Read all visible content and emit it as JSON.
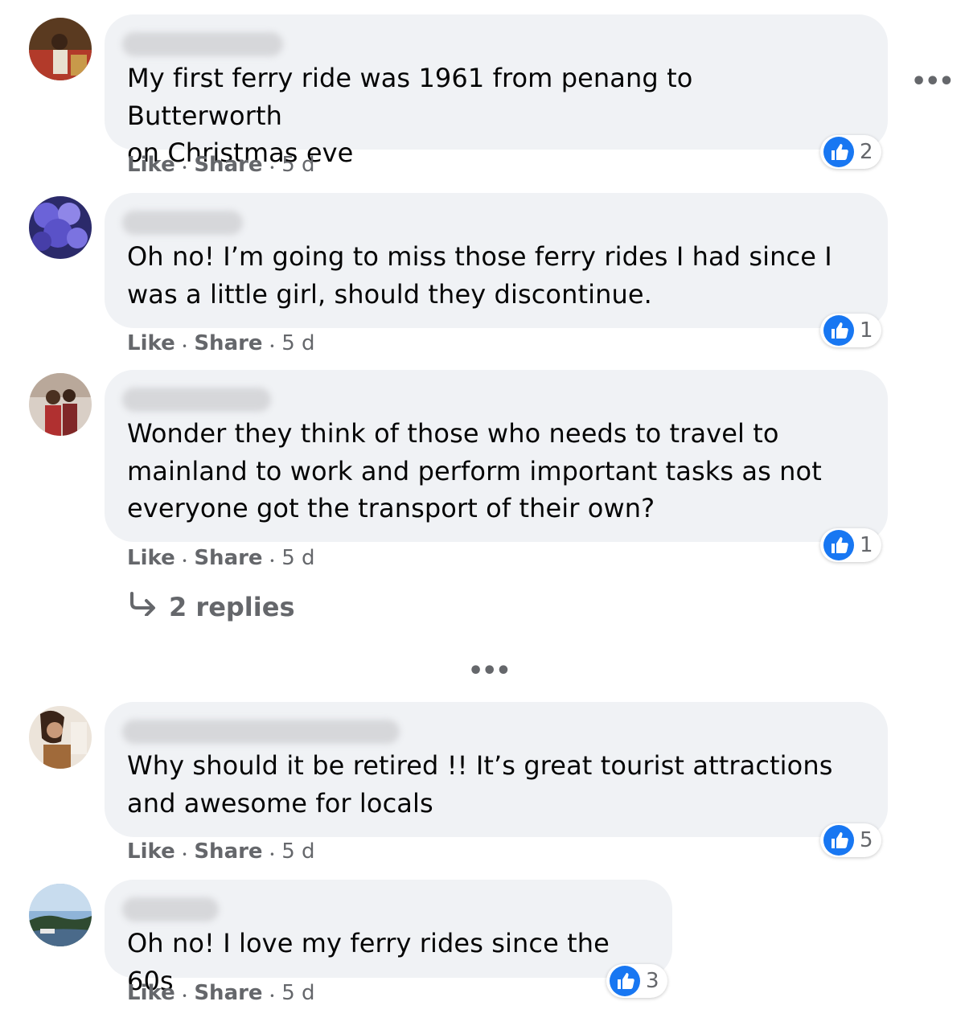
{
  "comments": [
    {
      "text": "My first ferry ride was 1961 from penang to Butterworth\non Christmas eve",
      "like_label": "Like",
      "share_label": "Share",
      "age": "5 d",
      "reactions": "2",
      "avatar_colors": [
        "#5a3a20",
        "#c89a4a"
      ]
    },
    {
      "text": "Oh no! I’m going to miss those ferry rides I had since I\nwas a little girl, should they discontinue.",
      "like_label": "Like",
      "share_label": "Share",
      "age": "5 d",
      "reactions": "1",
      "avatar_colors": [
        "#3b3a9c",
        "#8f86e8"
      ]
    },
    {
      "text": "Wonder they think of those who needs to travel to\nmainland to work and perform important tasks as not\neveryone got the transport of their own?",
      "like_label": "Like",
      "share_label": "Share",
      "age": "5 d",
      "reactions": "1",
      "replies_label": "2 replies",
      "avatar_colors": [
        "#c9b7a8",
        "#b03030"
      ]
    },
    {
      "text": "Why should it be retired !! It’s great tourist attractions\nand awesome for locals",
      "like_label": "Like",
      "share_label": "Share",
      "age": "5 d",
      "reactions": "5",
      "avatar_colors": [
        "#e3d6c8",
        "#7a4a2a"
      ]
    },
    {
      "text": "Oh no! I love my ferry rides since the 60s",
      "like_label": "Like",
      "share_label": "Share",
      "age": "5 d",
      "reactions": "3",
      "avatar_colors": [
        "#8fb4d8",
        "#2f4a30"
      ]
    }
  ],
  "separator": "•",
  "more_glyph": "•••",
  "colors": {
    "bubble": "#f0f2f5",
    "like_blue": "#1877f2",
    "meta_gray": "#65676b"
  }
}
